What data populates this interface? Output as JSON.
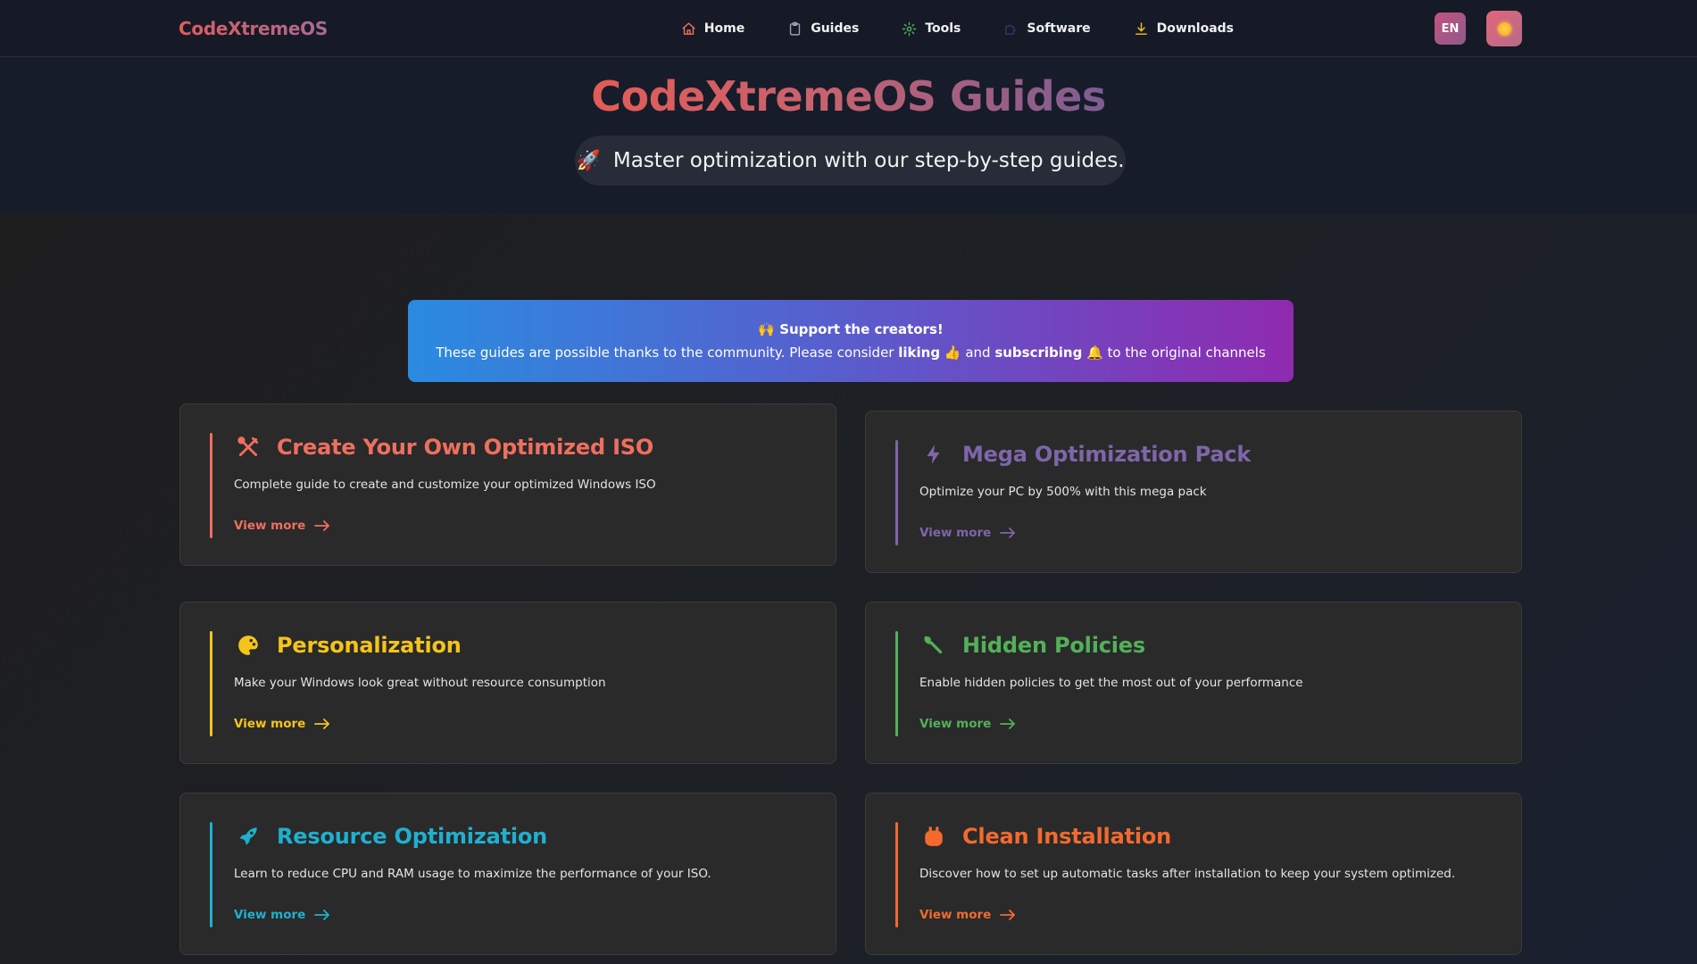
{
  "nav": {
    "brand": "CodeXtremeOS",
    "items": [
      {
        "label": "Home",
        "icon": "home-icon"
      },
      {
        "label": "Guides",
        "icon": "clipboard-icon"
      },
      {
        "label": "Tools",
        "icon": "gear-icon"
      },
      {
        "label": "Software",
        "icon": "puzzle-icon"
      },
      {
        "label": "Downloads",
        "icon": "download-icon"
      }
    ],
    "lang_label": "EN"
  },
  "hero": {
    "title": "CodeXtremeOS Guides",
    "subtitle": "Master optimization with our step-by-step guides.",
    "subtitle_emoji": "🚀"
  },
  "banner": {
    "emoji": "🙌",
    "title": "Support the creators!",
    "text_before": "These guides are possible thanks to the community. Please consider ",
    "liking": "liking",
    "like_emoji": "👍",
    "and": " and ",
    "subscribing": "subscribing",
    "bell_emoji": "🔔",
    "text_after": " to the original channels"
  },
  "cards": [
    {
      "title": "Create Your Own Optimized ISO",
      "desc": "Complete guide to create and customize your optimized Windows ISO",
      "more": "View more",
      "color": "#ef6f5e",
      "icon": "tools-icon"
    },
    {
      "title": "Mega Optimization Pack",
      "desc": "Optimize your PC by 500% with this mega pack",
      "more": "View more",
      "color": "#7e66a8",
      "icon": "lightning-icon"
    },
    {
      "title": "Personalization",
      "desc": "Make your Windows look great without resource consumption",
      "more": "View more",
      "color": "#f5c41a",
      "icon": "palette-icon"
    },
    {
      "title": "Hidden Policies",
      "desc": "Enable hidden policies to get the most out of your performance",
      "more": "View more",
      "color": "#52b158",
      "icon": "wrench-icon"
    },
    {
      "title": "Resource Optimization",
      "desc": "Learn to reduce CPU and RAM usage to maximize the performance of your ISO.",
      "more": "View more",
      "color": "#1fb0cf",
      "icon": "rocket-icon"
    },
    {
      "title": "Clean Installation",
      "desc": "Discover how to set up automatic tasks after installation to keep your system optimized.",
      "more": "View more",
      "color": "#f26a2e",
      "icon": "robot-icon"
    }
  ]
}
